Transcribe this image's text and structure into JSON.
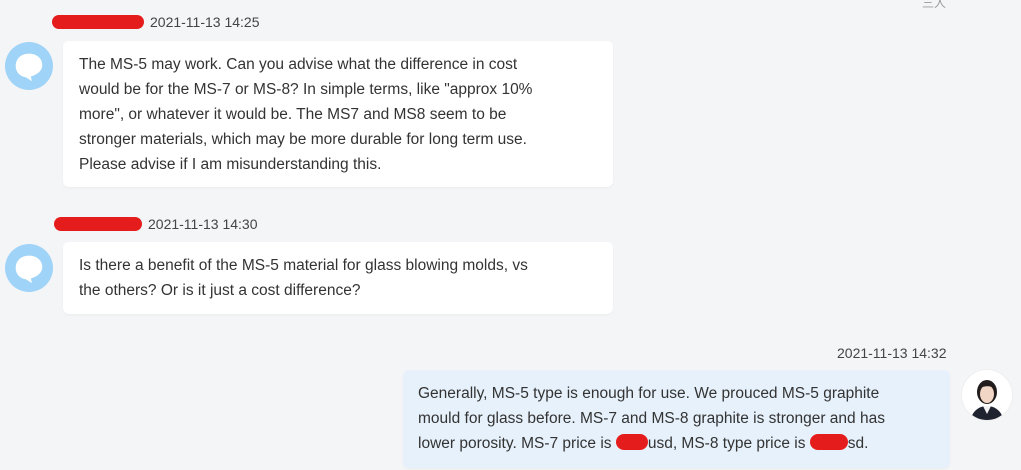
{
  "header": {
    "top_mark": "三人"
  },
  "messages": [
    {
      "sender": "incoming",
      "timestamp": "2021-11-13 14:25",
      "lines": [
        "The MS-5 may work. Can you advise what the difference in cost",
        "would be for the MS-7 or MS-8? In simple terms, like \"approx 10%",
        "more\", or whatever it would be. The MS7 and MS8 seem to be",
        "stronger materials, which may be more durable for long term use.",
        "Please advise if I am misunderstanding this."
      ]
    },
    {
      "sender": "incoming",
      "timestamp": "2021-11-13 14:30",
      "lines": [
        "Is there a benefit of the MS-5 material for glass blowing molds, vs",
        "the others? Or is it just a cost difference?"
      ]
    },
    {
      "sender": "outgoing",
      "timestamp": "2021-11-13 14:32",
      "lines": [
        "Generally, MS-5 type is enough for use. We prouced MS-5 graphite",
        "mould for glass before. MS-7 and MS-8 graphite is stronger and has"
      ],
      "last_line_parts": [
        "lower porosity. MS-7 price is ",
        "usd, MS-8 type price is ",
        "sd."
      ]
    }
  ],
  "colors": {
    "background": "#f4f5f7",
    "bubble_incoming": "#ffffff",
    "bubble_outgoing": "#e6f1fb",
    "redaction": "#e51c1c",
    "avatar_bubble": "#9fd3f7"
  },
  "icons": {
    "incoming_avatar": "chat-bubble-icon",
    "outgoing_avatar": "user-photo"
  }
}
